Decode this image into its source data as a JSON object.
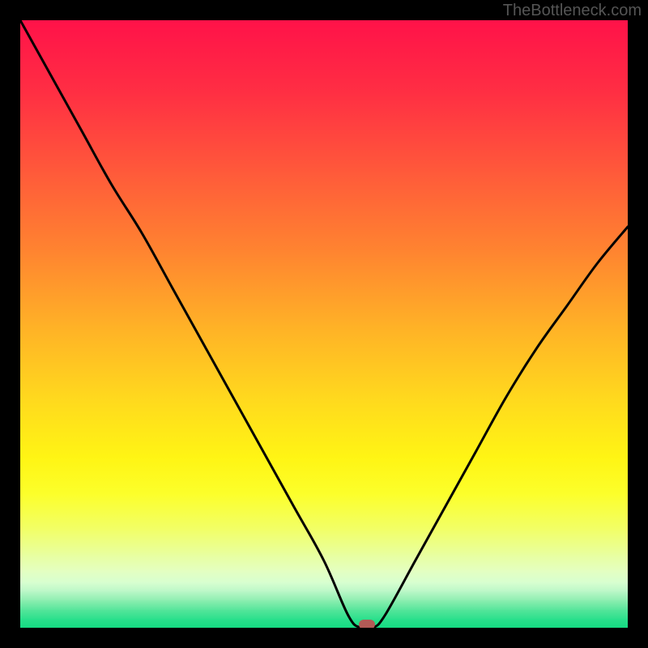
{
  "watermark": "TheBottleneck.com",
  "chart_data": {
    "type": "line",
    "title": "",
    "xlabel": "",
    "ylabel": "",
    "xlim": [
      0,
      100
    ],
    "ylim": [
      0,
      100
    ],
    "x": [
      0,
      5,
      10,
      15,
      20,
      25,
      30,
      35,
      40,
      45,
      50,
      54,
      56,
      58,
      60,
      65,
      70,
      75,
      80,
      85,
      90,
      95,
      100
    ],
    "values": [
      100,
      91,
      82,
      73,
      65,
      56,
      47,
      38,
      29,
      20,
      11,
      2,
      0,
      0,
      2,
      11,
      20,
      29,
      38,
      46,
      53,
      60,
      66
    ],
    "optimal_x": 57,
    "optimal_y": 0,
    "gradient_stops": [
      {
        "pos": 0.0,
        "color": "#ff1249"
      },
      {
        "pos": 0.12,
        "color": "#ff2f43"
      },
      {
        "pos": 0.25,
        "color": "#ff5a3a"
      },
      {
        "pos": 0.38,
        "color": "#ff8430"
      },
      {
        "pos": 0.5,
        "color": "#ffb027"
      },
      {
        "pos": 0.62,
        "color": "#ffd81e"
      },
      {
        "pos": 0.72,
        "color": "#fff514"
      },
      {
        "pos": 0.78,
        "color": "#fcff2b"
      },
      {
        "pos": 0.84,
        "color": "#f1ff6a"
      },
      {
        "pos": 0.88,
        "color": "#e8ffa0"
      },
      {
        "pos": 0.905,
        "color": "#e4ffc0"
      },
      {
        "pos": 0.925,
        "color": "#d7ffd0"
      },
      {
        "pos": 0.94,
        "color": "#baf7c7"
      },
      {
        "pos": 0.955,
        "color": "#8ceeb0"
      },
      {
        "pos": 0.97,
        "color": "#54e59a"
      },
      {
        "pos": 0.985,
        "color": "#2ae08c"
      },
      {
        "pos": 1.0,
        "color": "#14db82"
      }
    ]
  }
}
